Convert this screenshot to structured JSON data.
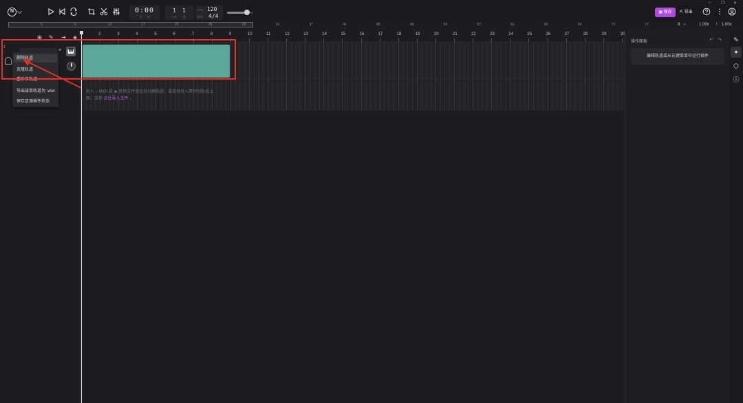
{
  "toolbar": {
    "logo_text": "N",
    "time": "0:00",
    "time_min_label": "分",
    "time_sec_label": "秒",
    "bar": "1",
    "beat": "1",
    "bar_label": "小节",
    "beat_label": "拍",
    "tempo": "120",
    "tempo_label": "BPM",
    "signature": "4/4",
    "signature_label": "拍号",
    "volume_level": 0.75,
    "save_label": "保存",
    "export_label": "导出",
    "icons": [
      "play-icon",
      "skip-back-icon",
      "loop-icon",
      "crop-icon",
      "scissors-icon",
      "mixer-icon",
      "help-icon",
      "more-icon",
      "account-icon"
    ]
  },
  "window": {
    "minimize": "–",
    "restore": "❐",
    "close": "✕"
  },
  "overview": {
    "numbers": [
      "5",
      "9",
      "13",
      "17",
      "21",
      "25",
      "29",
      "33",
      "37",
      "41",
      "45",
      "49",
      "53",
      "57",
      "61",
      "65",
      "69",
      "73",
      "77"
    ],
    "marker": "8",
    "h_zoom": "1.00x",
    "v_zoom": "1.00x"
  },
  "ruler": {
    "numbers": [
      "2",
      "3",
      "4",
      "5",
      "6",
      "7",
      "8",
      "9",
      "10",
      "11",
      "12",
      "13",
      "14",
      "15",
      "16",
      "17",
      "18",
      "19",
      "20",
      "21",
      "22",
      "23",
      "24",
      "25",
      "26",
      "27",
      "28",
      "29",
      "30"
    ]
  },
  "track": {
    "number": "1",
    "name": "",
    "fx_label": "≡",
    "instrument_icon": "piano-icon"
  },
  "context_menu": {
    "items": [
      "删除轨道",
      "克隆轨道",
      "重命名轨道",
      "导出该单轨道为 .wav",
      "保存音源插件状态"
    ]
  },
  "hint": {
    "line1": "拖入 ♪ MIDI 或 ◉ 音频文件到此处创建轨道，或直接拖入素材到轨道上",
    "line2_prefix": "面，或者 ",
    "line2_link": "点此导入文件",
    "line2_suffix": " 。"
  },
  "right_panel": {
    "title": "操作面板",
    "card_text": "编辑轨道或从右键菜单中运行插件"
  },
  "colors": {
    "accent": "#b14ae0",
    "clip": "#5ba89a",
    "annotation": "#e0302a"
  }
}
